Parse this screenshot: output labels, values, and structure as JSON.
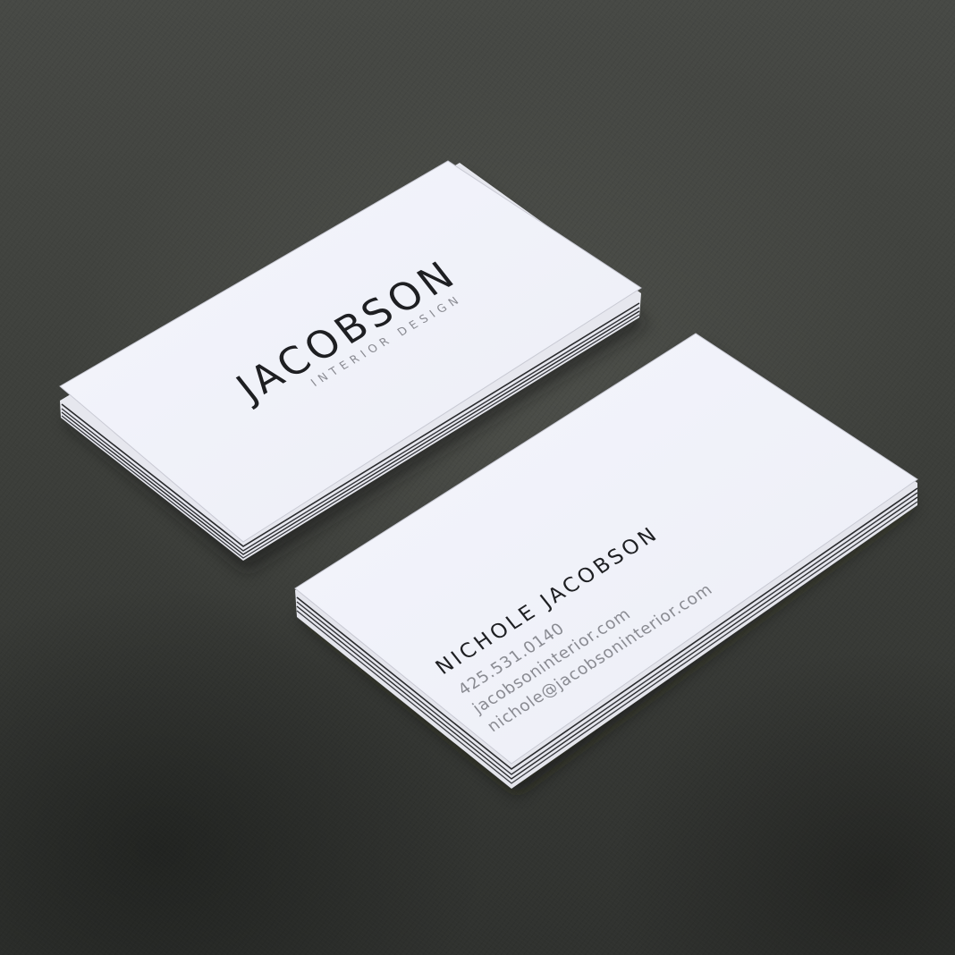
{
  "logo_card": {
    "brand_name": "JACOBSON",
    "tagline": "INTERIOR DESIGN"
  },
  "contact_card": {
    "name": "NICHOLE JACOBSON",
    "phone": "425.531.0140",
    "website": "jacobsoninterior.com",
    "email": "nichole@jacobsoninterior.com"
  },
  "colors": {
    "surface": "#3d3f3b",
    "card": "#f3f4fb",
    "card_edge": "#d9dae2",
    "ink_dark": "#1e1f22",
    "ink_gray": "#8a8b92"
  }
}
